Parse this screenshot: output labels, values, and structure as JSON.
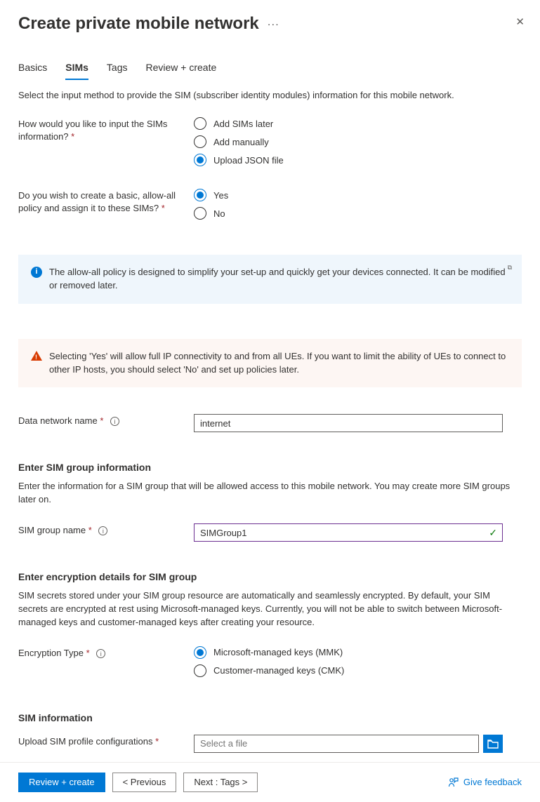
{
  "header": {
    "title": "Create private mobile network"
  },
  "tabs": {
    "basics": "Basics",
    "sims": "SIMs",
    "tags": "Tags",
    "review": "Review + create"
  },
  "intro": "Select the input method to provide the SIM (subscriber identity modules) information for this mobile network.",
  "input_method": {
    "label": "How would you like to input the SIMs information?",
    "opt_later": "Add SIMs later",
    "opt_manual": "Add manually",
    "opt_json": "Upload JSON file"
  },
  "allow_all": {
    "label": "Do you wish to create a basic, allow-all policy and assign it to these SIMs?",
    "opt_yes": "Yes",
    "opt_no": "No"
  },
  "info_alert": "The allow-all policy is designed to simplify your set-up and quickly get your devices connected. It can be modified or removed later.",
  "warn_alert": "Selecting 'Yes' will allow full IP connectivity to and from all UEs. If you want to limit the ability of UEs to connect to other IP hosts, you should select 'No' and set up policies later.",
  "data_network": {
    "label": "Data network name",
    "value": "internet"
  },
  "sim_group_section": {
    "title": "Enter SIM group information",
    "desc": "Enter the information for a SIM group that will be allowed access to this mobile network. You may create more SIM groups later on.",
    "name_label": "SIM group name",
    "name_value": "SIMGroup1"
  },
  "encryption_section": {
    "title": "Enter encryption details for SIM group",
    "desc": "SIM secrets stored under your SIM group resource are automatically and seamlessly encrypted. By default, your SIM secrets are encrypted at rest using Microsoft-managed keys. Currently, you will not be able to switch between Microsoft-managed keys and customer-managed keys after creating your resource.",
    "type_label": "Encryption Type",
    "opt_mmk": "Microsoft-managed keys (MMK)",
    "opt_cmk": "Customer-managed keys (CMK)"
  },
  "sim_info_section": {
    "title": "SIM information",
    "upload_label": "Upload SIM profile configurations",
    "placeholder": "Select a file"
  },
  "footer": {
    "review": "Review + create",
    "previous": "< Previous",
    "next": "Next : Tags >",
    "feedback": "Give feedback"
  },
  "glyphs": {
    "info": "i",
    "dots": "···",
    "check": "✓",
    "external": "⧉"
  }
}
